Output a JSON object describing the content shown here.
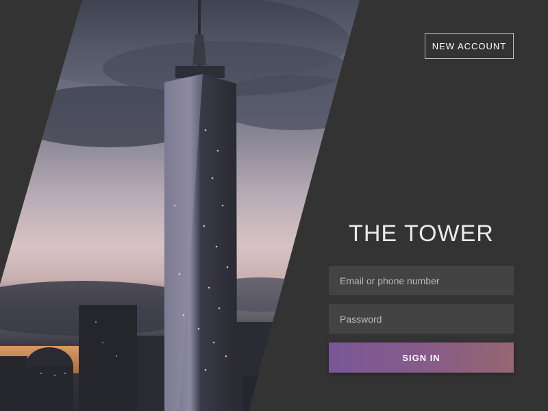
{
  "header": {
    "new_account_label": "NEW ACCOUNT"
  },
  "brand": {
    "title": "THE TOWER"
  },
  "form": {
    "email_placeholder": "Email or phone number",
    "password_placeholder": "Password",
    "signin_label": "SIGN IN"
  },
  "colors": {
    "background": "#333333",
    "field": "#444344",
    "button_start": "#7a5895",
    "button_end": "#966671"
  },
  "icons": {
    "hero": "tower-photo"
  }
}
